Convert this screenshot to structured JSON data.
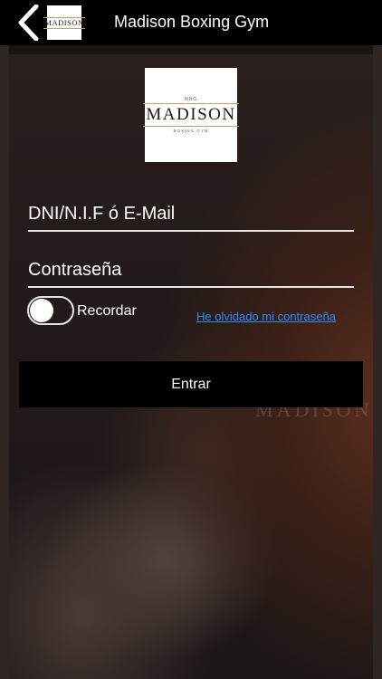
{
  "header": {
    "back_icon": "chevron-left-icon",
    "logo": {
      "top": "MBG",
      "name": "MADISON",
      "sub": "BOXING GYM"
    },
    "title": "Madison Boxing Gym"
  },
  "logo": {
    "top": "MBG",
    "name": "MADISON",
    "sub": "BOXING GYM"
  },
  "background": {
    "watermark": "MADiSON"
  },
  "form": {
    "user_placeholder": "DNI/N.I.F ó E-Mail",
    "password_placeholder": "Contraseña",
    "remember_label": "Recordar",
    "remember_on": false,
    "forgot_link": "He olvidado mi contraseña",
    "submit_label": "Entrar"
  },
  "colors": {
    "topbar": "#000000",
    "link": "#2a8cff",
    "logo_accent": "#c9a35a",
    "button": "#000000"
  }
}
